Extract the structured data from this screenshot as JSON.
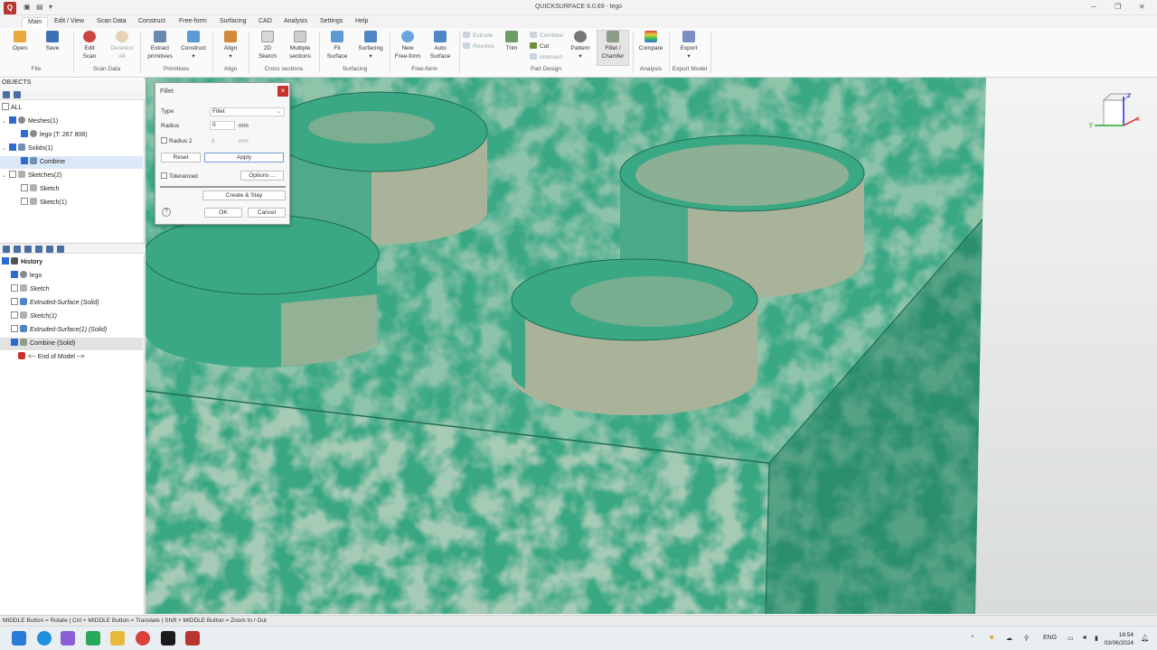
{
  "app": {
    "title": "QUICKSURFACE 6.0.69 - lego",
    "logo": "Q"
  },
  "menu": {
    "tabs": [
      "Main",
      "Edit / View",
      "Scan Data",
      "Construct",
      "Free-form",
      "Surfacing",
      "CAD",
      "Analysis",
      "Settings",
      "Help"
    ]
  },
  "ribbon": {
    "open": "Open",
    "save": "Save",
    "group_file": "File",
    "edit_scan": [
      "Edit",
      "Scan"
    ],
    "deselect_all": [
      "Deselect",
      "All"
    ],
    "group_scan": "Scan Data",
    "extract_primitives": [
      "Extract",
      "primitives"
    ],
    "construct": "Construct",
    "group_primitives": "Primitives",
    "align": "Align",
    "group_align": "Align",
    "sketch_2d": [
      "2D",
      "Sketch"
    ],
    "multiple_sections": [
      "Multiple",
      "sections"
    ],
    "group_cross": "Cross sections",
    "fit_surface": [
      "Fit",
      "Surface"
    ],
    "surfacing": "Surfacing",
    "group_surfacing": "Surfacing",
    "new_freeform": [
      "New",
      "Free-form"
    ],
    "auto_surface": [
      "Auto",
      "Surface"
    ],
    "group_freeform": "Free-form",
    "extrude": "Extrude",
    "revolve": "Revolve",
    "trim": "Trim",
    "combine": "Combine",
    "cut": "Cut",
    "intersect": "Intersect",
    "pattern": "Pattern",
    "fillet_chamfer": [
      "Fillet /",
      "Chamfer"
    ],
    "group_part": "Part Design",
    "compare": "Compare",
    "group_analysis": "Analysis",
    "export": "Export",
    "group_export": "Export Model"
  },
  "objects": {
    "header": "OBJECTS",
    "items": [
      {
        "label": "ALL"
      },
      {
        "label": "Meshes(1)"
      },
      {
        "label": "lego (T: 267 808)"
      },
      {
        "label": "Solids(1)"
      },
      {
        "label": "Combine"
      },
      {
        "label": "Sketches(2)"
      },
      {
        "label": "Sketch"
      },
      {
        "label": "Sketch(1)"
      }
    ]
  },
  "history": {
    "header": "History",
    "items": [
      {
        "label": "lego"
      },
      {
        "label": "Sketch"
      },
      {
        "label": "Extruded-Surface (Solid)"
      },
      {
        "label": "Sketch(1)"
      },
      {
        "label": "Extruded-Surface(1) (Solid)"
      },
      {
        "label": "Combine (Solid)"
      },
      {
        "label": "<-- End of Model -->"
      }
    ]
  },
  "dialog": {
    "title": "Fillet",
    "close": "×",
    "type_label": "Type",
    "type_value": "Fillet",
    "radius_label": "Radius",
    "radius_value": "0",
    "radius_unit": "mm",
    "radius2_label": "Radius 2",
    "radius2_value": "0",
    "radius2_unit": "mm",
    "reset": "Reset",
    "apply": "Apply",
    "toleranced": "Toleranced",
    "options": "Options ...",
    "create_stay": "Create & Stay",
    "help": "?",
    "ok": "OK",
    "cancel": "Cancel"
  },
  "axis": {
    "x": "x",
    "y": "y",
    "z": "z"
  },
  "status": {
    "hint": "MIDDLE Button = Rotate | Ctrl + MIDDLE Button = Translate | Shift + MIDDLE Button = Zoom In / Out"
  },
  "taskbar": {
    "lang": "ENG",
    "time": "16:54",
    "date": "03/06/2024"
  },
  "colors": {
    "brick": "#3aa884",
    "scan": "#a9b39a",
    "accent": "#2d6bd0",
    "close_red": "#c8302c"
  }
}
